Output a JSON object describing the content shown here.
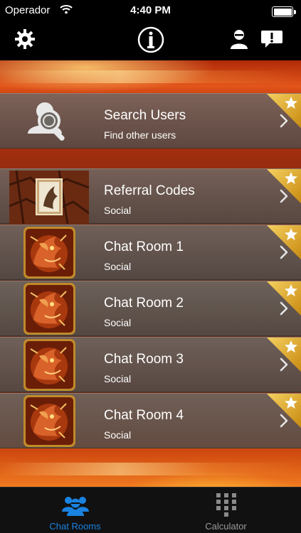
{
  "status_bar": {
    "carrier": "Operador",
    "time": "4:40 PM",
    "battery_level": 1.0
  },
  "nav_bar": {
    "left_icon": "gear-icon",
    "center_icon": "info-icon",
    "right_icons": [
      "user-icon",
      "chat-alert-icon"
    ]
  },
  "rows": [
    {
      "title": "Search Users",
      "subtitle": "Find other users",
      "thumbnail": "search-users-icon",
      "badge": "star"
    },
    {
      "title": "Referral Codes",
      "subtitle": "Social",
      "thumbnail": "referral-card-image",
      "badge": "star"
    },
    {
      "title": "Chat Room 1",
      "subtitle": "Social",
      "thumbnail": "dragon-image",
      "badge": "star"
    },
    {
      "title": "Chat Room 2",
      "subtitle": "Social",
      "thumbnail": "dragon-image",
      "badge": "star"
    },
    {
      "title": "Chat Room 3",
      "subtitle": "Social",
      "thumbnail": "dragon-image",
      "badge": "star"
    },
    {
      "title": "Chat Room 4",
      "subtitle": "Social",
      "thumbnail": "dragon-image",
      "badge": "star"
    }
  ],
  "tab_bar": {
    "tabs": [
      {
        "label": "Chat Rooms",
        "icon": "group-icon",
        "selected": true
      },
      {
        "label": "Calculator",
        "icon": "keypad-icon",
        "selected": false
      }
    ]
  },
  "colors": {
    "accent": "#1a82e0",
    "badge_gold": "#e8b420",
    "row_bg": "#6e6863"
  }
}
